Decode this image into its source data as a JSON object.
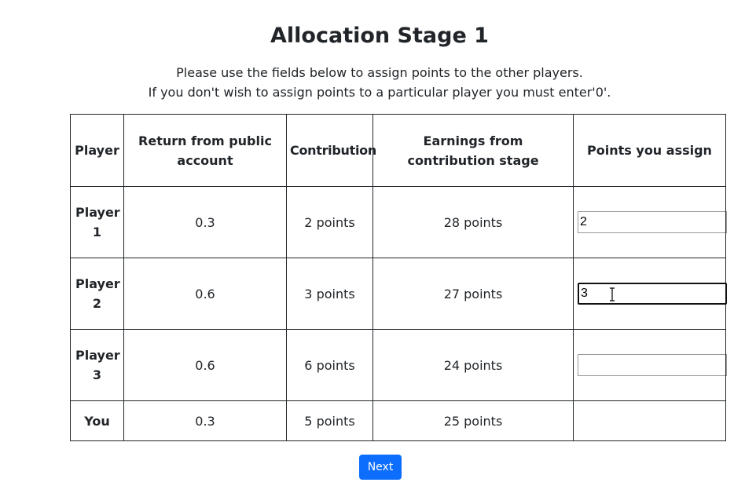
{
  "page": {
    "title": "Allocation Stage 1",
    "instructions": [
      "Please use the fields below to assign points to the other players.",
      "If you don't wish to assign points to a particular player you must enter'0'."
    ]
  },
  "table": {
    "headers": {
      "player": "Player",
      "return": "Return from public account",
      "contribution": "Contribution",
      "earnings": "Earnings from contribution stage",
      "points": "Points you assign"
    },
    "rows": [
      {
        "player": "Player 1",
        "return": "0.3",
        "contribution": "2 points",
        "earnings": "28 points",
        "assigned": "2"
      },
      {
        "player": "Player 2",
        "return": "0.6",
        "contribution": "3 points",
        "earnings": "27 points",
        "assigned": "3"
      },
      {
        "player": "Player 3",
        "return": "0.6",
        "contribution": "6 points",
        "earnings": "24 points",
        "assigned": ""
      },
      {
        "player": "You",
        "return": "0.3",
        "contribution": "5 points",
        "earnings": "25 points"
      }
    ]
  },
  "next_button": {
    "label": "Next",
    "color": "#0d6efd"
  },
  "focused_field": "Player 2 points input",
  "icons": {
    "cursor": "text-ibeam-cursor-icon"
  }
}
